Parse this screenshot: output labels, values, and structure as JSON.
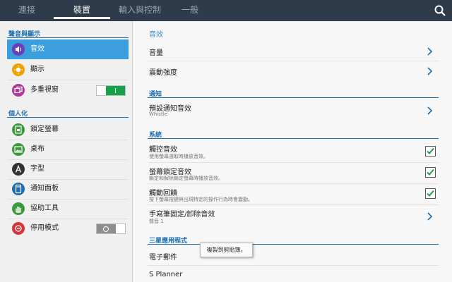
{
  "tabs": [
    {
      "label": "連接"
    },
    {
      "label": "裝置"
    },
    {
      "label": "輸入與控制"
    },
    {
      "label": "一般"
    }
  ],
  "search": {
    "icon": "search-icon"
  },
  "sidebar": {
    "sections": [
      {
        "label": "聲音與顯示"
      },
      {
        "label": "個人化"
      }
    ],
    "items": [
      {
        "label": "音效",
        "icon": "volume-icon",
        "color": "#6a3fb7"
      },
      {
        "label": "顯示",
        "icon": "brightness-icon",
        "color": "#f0a100"
      },
      {
        "label": "多重視窗",
        "icon": "multi-window-icon",
        "color": "#b03a9a",
        "toggle": "on"
      },
      {
        "label": "鎖定螢幕",
        "icon": "lock-screen-icon",
        "color": "#3d9a3c"
      },
      {
        "label": "桌布",
        "icon": "wallpaper-icon",
        "color": "#3d9a3c"
      },
      {
        "label": "字型",
        "icon": "font-icon",
        "color": "#333333"
      },
      {
        "label": "通知面板",
        "icon": "notification-panel-icon",
        "color": "#1d6fb3"
      },
      {
        "label": "協助工具",
        "icon": "accessibility-icon",
        "color": "#3d9a3c"
      },
      {
        "label": "停用模式",
        "icon": "blocking-mode-icon",
        "color": "#d8333a",
        "toggle": "off"
      }
    ]
  },
  "main": {
    "title": "音效",
    "rows_sound": [
      {
        "title": "音量"
      },
      {
        "title": "震動強度"
      }
    ],
    "notify_header": "通知",
    "notify_row": {
      "title": "預設通知音效",
      "subtitle": "Whistle"
    },
    "system_header": "系統",
    "system_rows": [
      {
        "title": "觸控音效",
        "subtitle": "使用螢幕選取時播放音效。",
        "checked": true
      },
      {
        "title": "螢幕鎖定音效",
        "subtitle": "鎖定和解除鎖定螢幕時播放音效。",
        "checked": true
      },
      {
        "title": "觸動回饋",
        "subtitle": "按下螢幕按鍵與出現特定的操作行為時會震動。",
        "checked": true
      }
    ],
    "pen_row": {
      "title": "手寫筆固定/卸除音效",
      "subtitle": "聲音 1"
    },
    "samsung_header": "三星應用程式",
    "apps": [
      {
        "title": "電子郵件"
      },
      {
        "title": "S Planner"
      }
    ]
  },
  "tooltip": "複製到剪貼簿。",
  "colors": {
    "accent": "#3a9fdc",
    "topbar": "#2d3b4a",
    "check": "#19a04b"
  }
}
